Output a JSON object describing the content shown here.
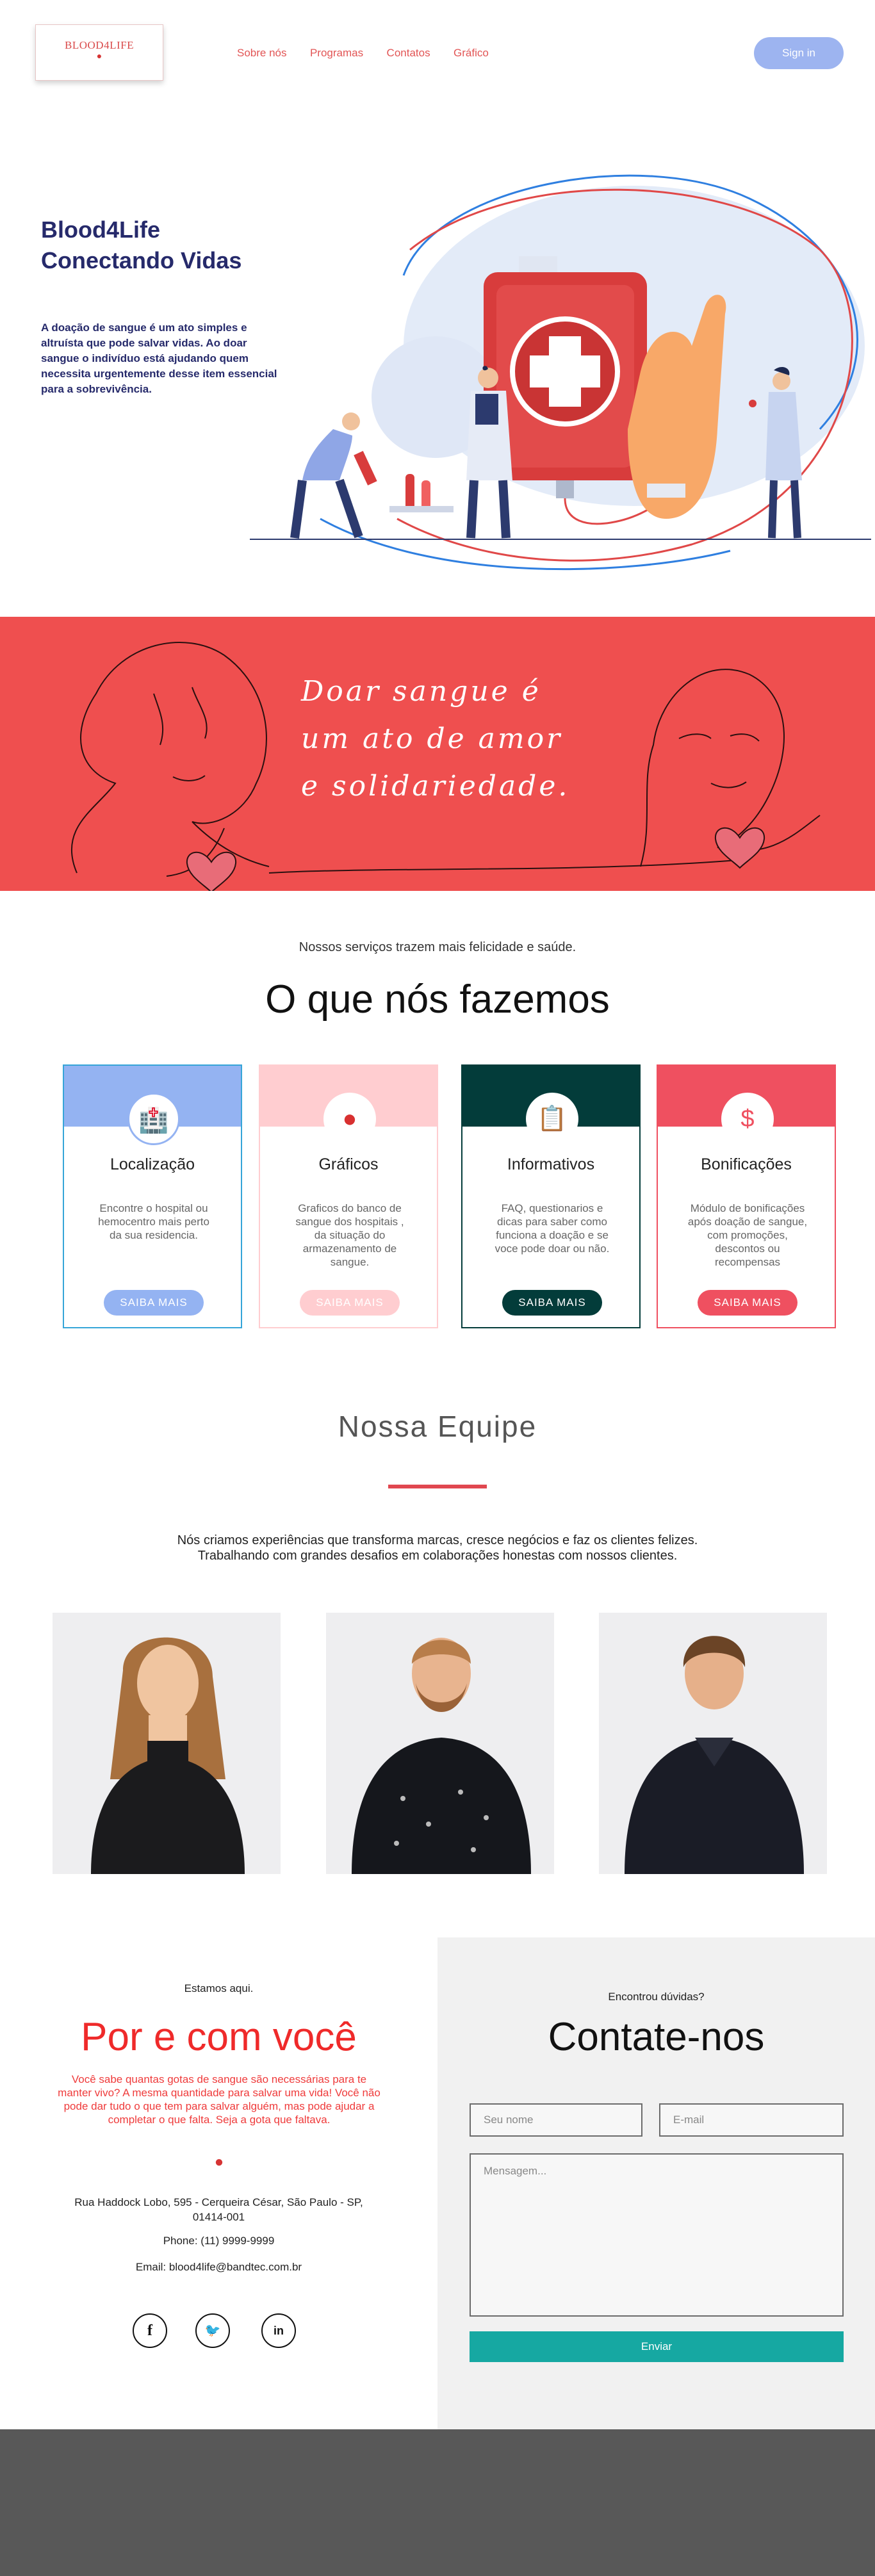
{
  "nav": {
    "logo": "BLOOD4LIFE",
    "links": [
      "Sobre nós",
      "Programas",
      "Contatos",
      "Gráfico"
    ],
    "signin": "Sign in"
  },
  "hero": {
    "title_line1": "Blood4Life",
    "title_line2": "Conectando Vidas",
    "description": "A doação de sangue é um ato simples e altruísta que pode salvar vidas. Ao doar sangue o indivíduo está ajudando quem necessita urgentemente desse item essencial para a sobrevivência."
  },
  "banner": {
    "line1": "Doar sangue é",
    "line2": "um ato de amor",
    "line3": "e solidariedade."
  },
  "services": {
    "subtitle": "Nossos serviços trazem mais felicidade e saúde.",
    "title": "O que nós fazemos",
    "cards": [
      {
        "title": "Localização",
        "description": "Encontre o hospital ou hemocentro mais perto da sua residencia.",
        "button": "SAIBA MAIS",
        "accent": "#94b3f2",
        "icon": "hospital-icon"
      },
      {
        "title": "Gráficos",
        "description": "Graficos do banco de sangue dos hospitais , da situação do armazenamento de sangue.",
        "button": "SAIBA MAIS",
        "accent": "#ffcdd0",
        "icon": "blood-drop-icon"
      },
      {
        "title": "Informativos",
        "description": "FAQ, questionarios e dicas para saber como funciona a doação e se voce pode doar ou não.",
        "button": "SAIBA MAIS",
        "accent": "#033c3a",
        "icon": "clipboard-icon"
      },
      {
        "title": "Bonificações",
        "description": "Módulo de bonificações após doação de sangue, com promoções, descontos ou recompensas",
        "button": "SAIBA MAIS",
        "accent": "#ef5060",
        "icon": "price-tag-icon"
      }
    ]
  },
  "team": {
    "title": "Nossa Equipe",
    "desc_line1": "Nós criamos experiências que transforma marcas, cresce negócios e faz os clientes felizes.",
    "desc_line2": "Trabalhando com grandes desafios em colaborações honestas com nossos clientes."
  },
  "contact": {
    "left_small": "Estamos aqui.",
    "left_title": "Por e com você",
    "left_copy": "Você sabe quantas gotas de sangue são necessárias para te manter vivo? A mesma quantidade para salvar uma vida! Você não pode dar tudo o que tem para salvar alguém, mas pode ajudar a completar o que falta. Seja a gota que faltava.",
    "address": "Rua Haddock Lobo, 595 - Cerqueira César, São Paulo - SP, 01414-001",
    "phone": "Phone: (11) 9999-9999",
    "email": "Email: blood4life@bandtec.com.br",
    "right_small": "Encontrou dúvidas?",
    "right_title": "Contate-nos",
    "name_placeholder": "Seu nome",
    "email_placeholder": "E-mail",
    "message_placeholder": "Mensagem...",
    "send": "Enviar"
  }
}
